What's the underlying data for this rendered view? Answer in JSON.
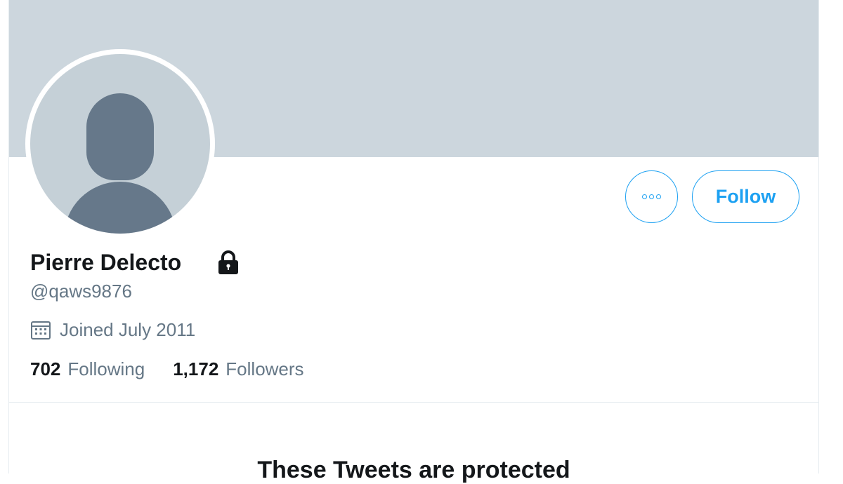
{
  "profile": {
    "display_name": "Pierre Delecto",
    "handle": "@qaws9876",
    "joined": "Joined July 2011",
    "protected": true
  },
  "actions": {
    "more_icon": "more-horizontal-icon",
    "follow_label": "Follow"
  },
  "stats": {
    "following_count": "702",
    "following_label": "Following",
    "followers_count": "1,172",
    "followers_label": "Followers"
  },
  "protected_notice": {
    "title": "These Tweets are protected"
  },
  "colors": {
    "accent": "#1da1f2",
    "banner": "#ccd6dd",
    "avatar_bg": "#c5d0d7",
    "avatar_silhouette": "#66788a",
    "text_primary": "#14171a",
    "text_secondary": "#657786"
  }
}
